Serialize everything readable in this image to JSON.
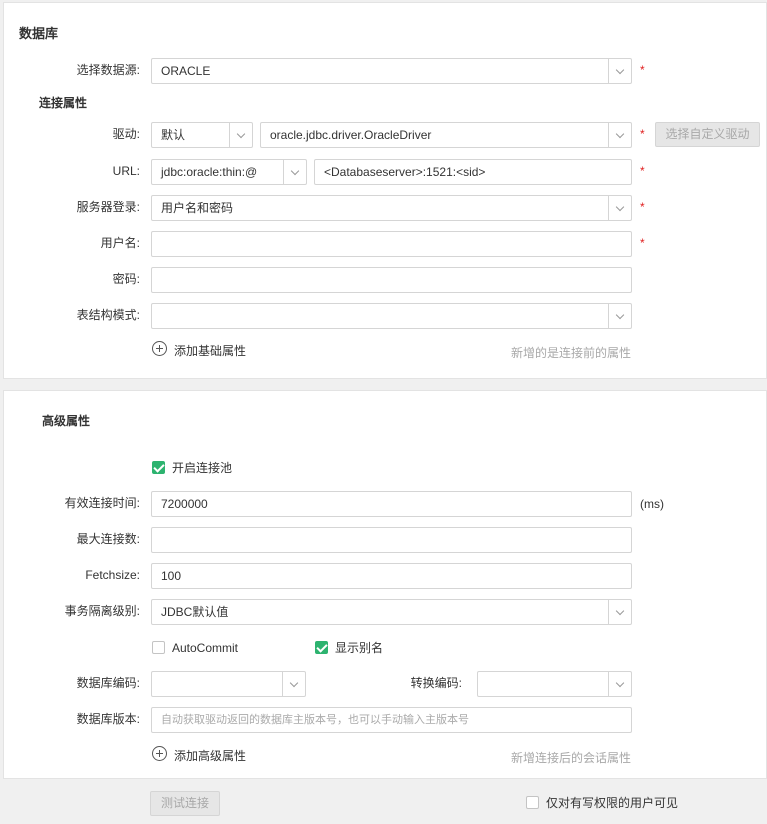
{
  "database": {
    "title": "数据库",
    "datasource_label": "选择数据源:",
    "datasource_value": "ORACLE"
  },
  "connection": {
    "title": "连接属性",
    "driver_label": "驱动:",
    "driver_mode": "默认",
    "driver_class": "oracle.jdbc.driver.OracleDriver",
    "custom_driver_button": "选择自定义驱动",
    "url_label": "URL:",
    "url_prefix": "jdbc:oracle:thin:@",
    "url_value": "<Databaseserver>:1521:<sid>",
    "server_login_label": "服务器登录:",
    "server_login_value": "用户名和密码",
    "username_label": "用户名:",
    "username_value": "",
    "password_label": "密码:",
    "password_value": "",
    "schema_label": "表结构模式:",
    "schema_value": "",
    "add_basic_property": "添加基础属性",
    "basic_hint": "新增的是连接前的属性"
  },
  "advanced": {
    "title": "高级属性",
    "enable_pool_label": "开启连接池",
    "enable_pool_checked": true,
    "valid_time_label": "有效连接时间:",
    "valid_time_value": "7200000",
    "valid_time_unit": "(ms)",
    "max_conn_label": "最大连接数:",
    "max_conn_value": "",
    "fetchsize_label": "Fetchsize:",
    "fetchsize_value": "100",
    "isolation_label": "事务隔离级别:",
    "isolation_value": "JDBC默认值",
    "autocommit_label": "AutoCommit",
    "autocommit_checked": false,
    "show_alias_label": "显示别名",
    "show_alias_checked": true,
    "db_encoding_label": "数据库编码:",
    "db_encoding_value": "",
    "convert_encoding_label": "转换编码:",
    "convert_encoding_value": "",
    "db_version_label": "数据库版本:",
    "db_version_placeholder": "自动获取驱动返回的数据库主版本号，也可以手动输入主版本号",
    "add_advanced_property": "添加高级属性",
    "advanced_hint": "新增连接后的会话属性"
  },
  "footer": {
    "test_button": "测试连接",
    "write_only_label": "仅对有写权限的用户可见",
    "write_only_checked": false
  },
  "colors": {
    "required": "#e02020",
    "checkbox_green": "#2db36f"
  }
}
